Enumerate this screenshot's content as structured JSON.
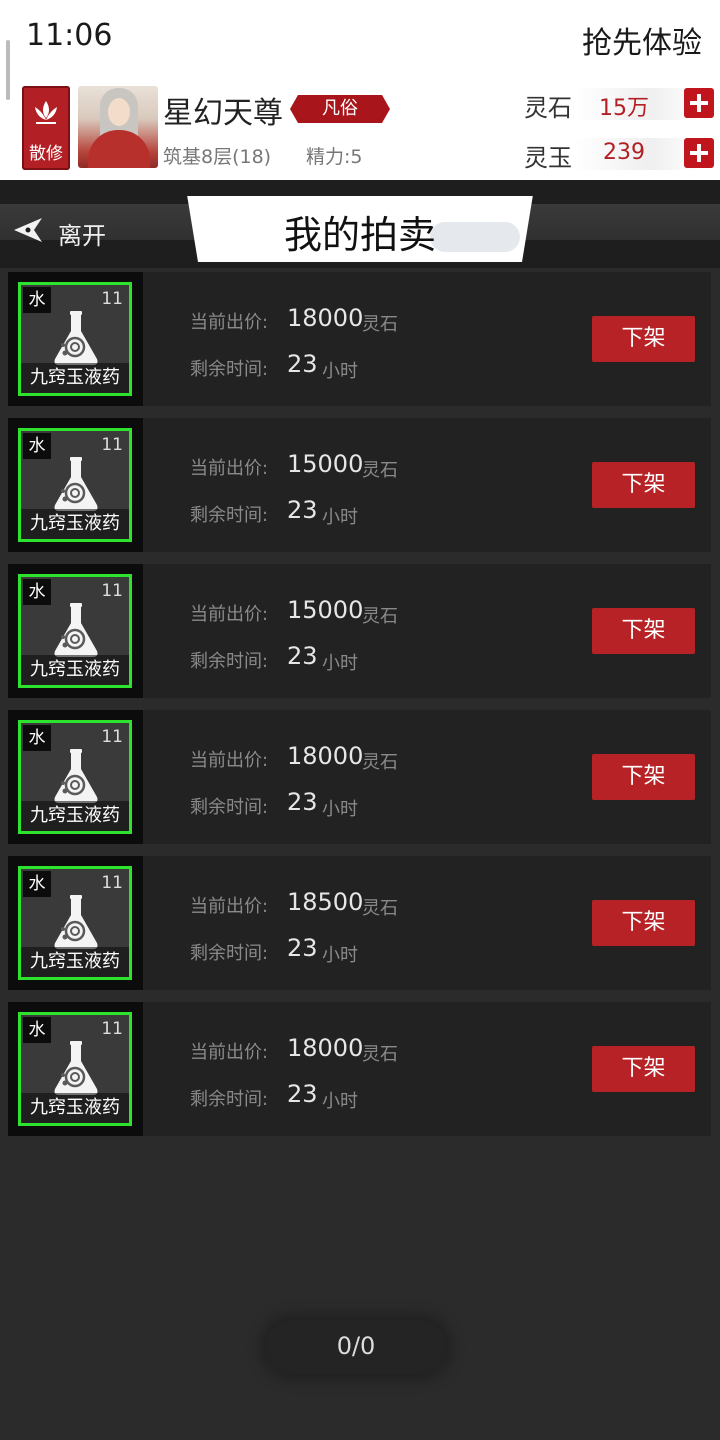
{
  "status": {
    "time": "11:06",
    "early_access": "抢先体验"
  },
  "player": {
    "sect": "散修",
    "name": "星幻天尊",
    "rank": "凡俗",
    "realm": "筑基8层(18)",
    "energy": "精力:5"
  },
  "currencies": [
    {
      "label": "灵石",
      "value": "15万"
    },
    {
      "label": "灵玉",
      "value": "239"
    }
  ],
  "header": {
    "back_label": "离开",
    "title": "我的拍卖"
  },
  "listing_labels": {
    "price": "当前出价:",
    "price_unit": "灵石",
    "time": "剩余时间:",
    "time_unit": "小时",
    "delist": "下架"
  },
  "listings": [
    {
      "element": "水",
      "level": "11",
      "name": "九窍玉液药",
      "price": "18000",
      "time": "23"
    },
    {
      "element": "水",
      "level": "11",
      "name": "九窍玉液药",
      "price": "15000",
      "time": "23"
    },
    {
      "element": "水",
      "level": "11",
      "name": "九窍玉液药",
      "price": "15000",
      "time": "23"
    },
    {
      "element": "水",
      "level": "11",
      "name": "九窍玉液药",
      "price": "18000",
      "time": "23"
    },
    {
      "element": "水",
      "level": "11",
      "name": "九窍玉液药",
      "price": "18500",
      "time": "23"
    },
    {
      "element": "水",
      "level": "11",
      "name": "九窍玉液药",
      "price": "18000",
      "time": "23"
    }
  ],
  "pager": {
    "text": "0/0"
  },
  "colors": {
    "accent_red": "#b72226",
    "rarity_green": "#2ee32e",
    "background": "#2b2b2b"
  }
}
